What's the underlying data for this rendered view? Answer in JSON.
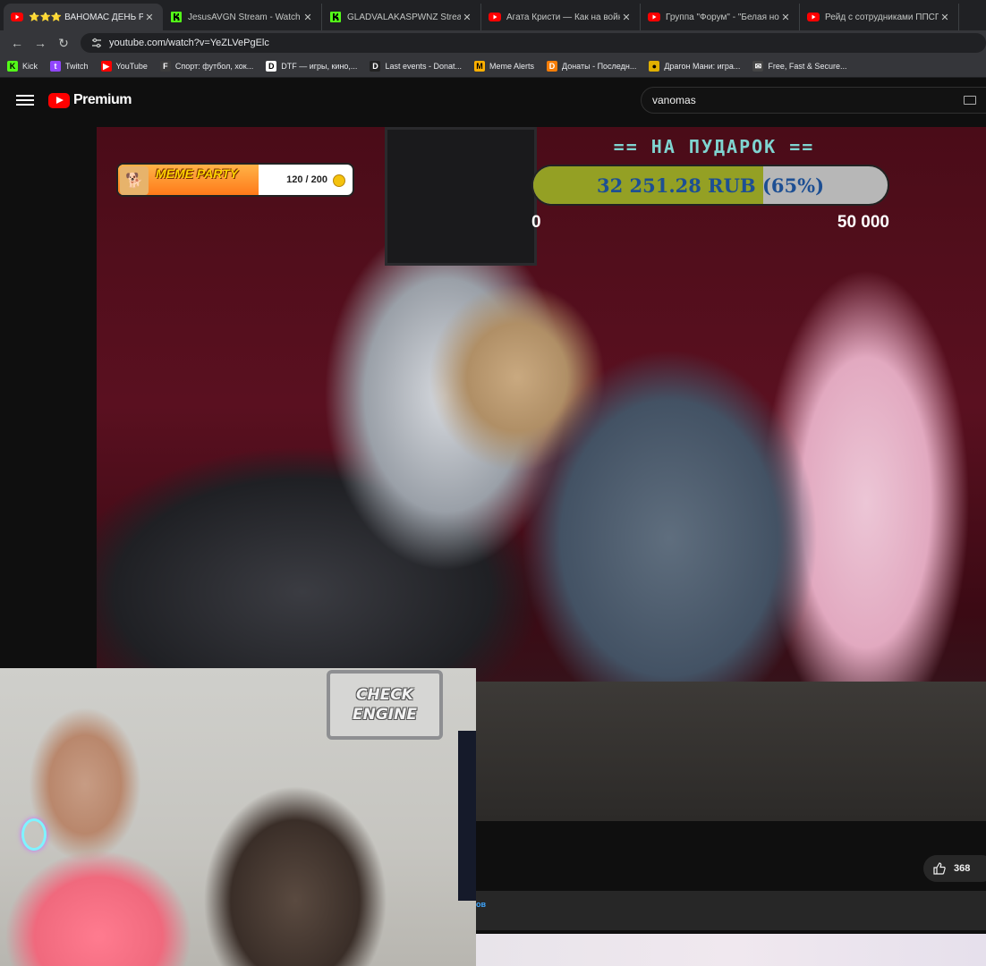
{
  "tabs": [
    {
      "title": "⭐⭐⭐ ВАНОМАС ДЕНЬ РОЖ",
      "favicon": "youtube",
      "active": true
    },
    {
      "title": "JesusAVGN Stream - Watch Live",
      "favicon": "kick",
      "active": false
    },
    {
      "title": "GLADVALAKASPWNZ Stream - ",
      "favicon": "kick",
      "active": false
    },
    {
      "title": "Агата Кристи — Как на войне",
      "favicon": "youtube",
      "active": false
    },
    {
      "title": "Группа \"Форум\" - \"Белая ночь",
      "favicon": "youtube",
      "active": false
    },
    {
      "title": "Рейд с сотрудниками ППСП УМ",
      "favicon": "youtube",
      "active": false
    }
  ],
  "close_glyph": "✕",
  "nav": {
    "back": "←",
    "forward": "→",
    "reload": "↻"
  },
  "address": {
    "url": "youtube.com/watch?v=YeZLVePgElc"
  },
  "bookmarks": [
    {
      "label": "Kick",
      "icon": "kick-icon",
      "glyph": "K",
      "color": "#53fc18",
      "fg": "#000"
    },
    {
      "label": "Twitch",
      "icon": "twitch-icon",
      "glyph": "t",
      "color": "#9146ff",
      "fg": "#fff"
    },
    {
      "label": "YouTube",
      "icon": "youtube-icon",
      "glyph": "▶",
      "color": "#ff0000",
      "fg": "#fff"
    },
    {
      "label": "Спорт: футбол, хок...",
      "icon": "sport-icon",
      "glyph": "F",
      "color": "#3c3c3c",
      "fg": "#fff"
    },
    {
      "label": "DTF — игры, кино,...",
      "icon": "dtf-icon",
      "glyph": "D",
      "color": "#ffffff",
      "fg": "#000"
    },
    {
      "label": "Last events - Donat...",
      "icon": "donat-icon",
      "glyph": "D",
      "color": "#222222",
      "fg": "#fff"
    },
    {
      "label": "Meme Alerts",
      "icon": "memealerts-icon",
      "glyph": "M",
      "color": "#ffb000",
      "fg": "#000"
    },
    {
      "label": "Донаты - Последн...",
      "icon": "donations-icon",
      "glyph": "D",
      "color": "#f57d07",
      "fg": "#fff"
    },
    {
      "label": "Драгон Мани: игра...",
      "icon": "dragon-money-icon",
      "glyph": "●",
      "color": "#e0b000",
      "fg": "#000"
    },
    {
      "label": "Free, Fast & Secure...",
      "icon": "mail-icon",
      "glyph": "✉",
      "color": "#444444",
      "fg": "#fff"
    }
  ],
  "youtube": {
    "brand": "Premium",
    "search_query": "vanomas"
  },
  "overlay": {
    "meme_party": {
      "title": "MEME PARTY",
      "count": "120 / 200",
      "progress": 0.6
    },
    "goal": {
      "title": "== НА ПУДАРОК ==",
      "amount_text": "32 251.28 RUB (65%)",
      "progress": 0.65,
      "min": "0",
      "max": "50 000"
    }
  },
  "webcam_sign": {
    "line1": "CHECK",
    "line2": "ENGINE"
  },
  "actions": {
    "like_count": "368"
  },
  "description_snippet": "ов",
  "colors": {
    "youtube_red": "#ff0000",
    "goal_fill": "#94a024",
    "goal_text": "#1d4f93",
    "goal_title": "#7fd4d0"
  }
}
